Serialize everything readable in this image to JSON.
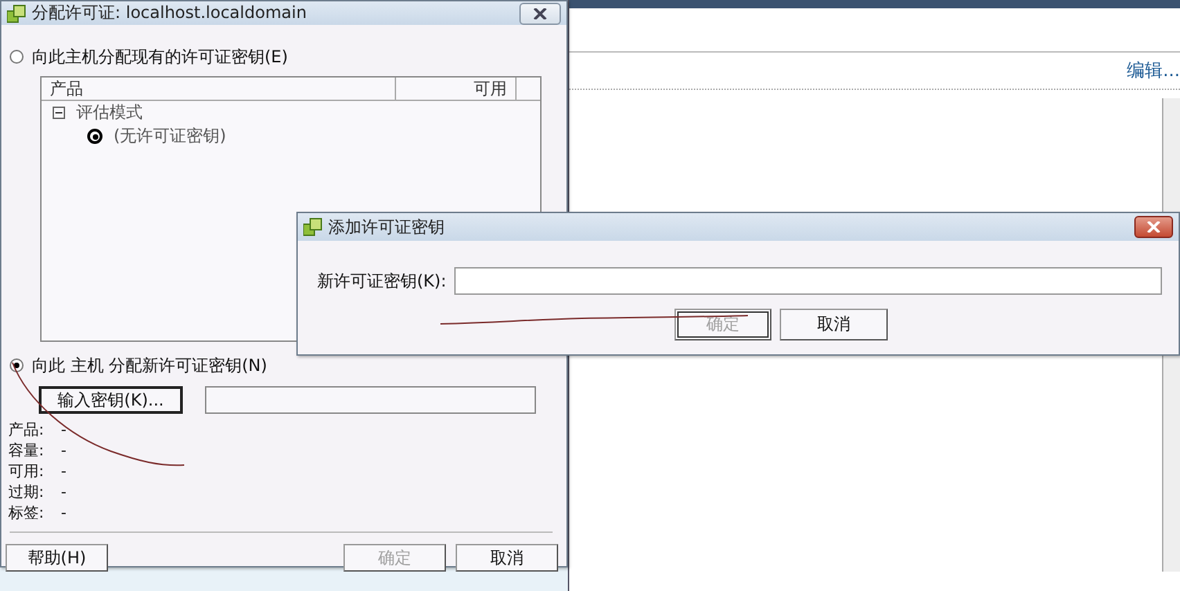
{
  "background_window": {
    "edit_link": "编辑..."
  },
  "assign_dialog": {
    "title": "分配许可证: localhost.localdomain",
    "options": [
      {
        "label": "向此主机分配现有的许可证密钥(E)",
        "selected": false
      },
      {
        "label": "向此 主机 分配新许可证密钥(N)",
        "selected": true
      }
    ],
    "license_table": {
      "columns": [
        "产品",
        "可用"
      ],
      "tree": [
        {
          "label": "评估模式",
          "expanded": true,
          "children": [
            {
              "label": "(无许可证密钥)",
              "selected": true
            }
          ]
        }
      ]
    },
    "enter_key_button": "输入密钥(K)...",
    "details": [
      {
        "label": "产品:",
        "value": "-"
      },
      {
        "label": "容量:",
        "value": "-"
      },
      {
        "label": "可用:",
        "value": "-"
      },
      {
        "label": "过期:",
        "value": "-"
      },
      {
        "label": "标签:",
        "value": "-"
      }
    ],
    "buttons": [
      {
        "label": "帮助(H)",
        "disabled": false
      },
      {
        "label": "确定",
        "disabled": true
      },
      {
        "label": "取消",
        "disabled": false
      }
    ]
  },
  "add_key_dialog": {
    "title": "添加许可证密钥",
    "field_label": "新许可证密钥(K):",
    "buttons": [
      {
        "label": "确定",
        "disabled": true
      },
      {
        "label": "取消",
        "disabled": false
      }
    ]
  }
}
